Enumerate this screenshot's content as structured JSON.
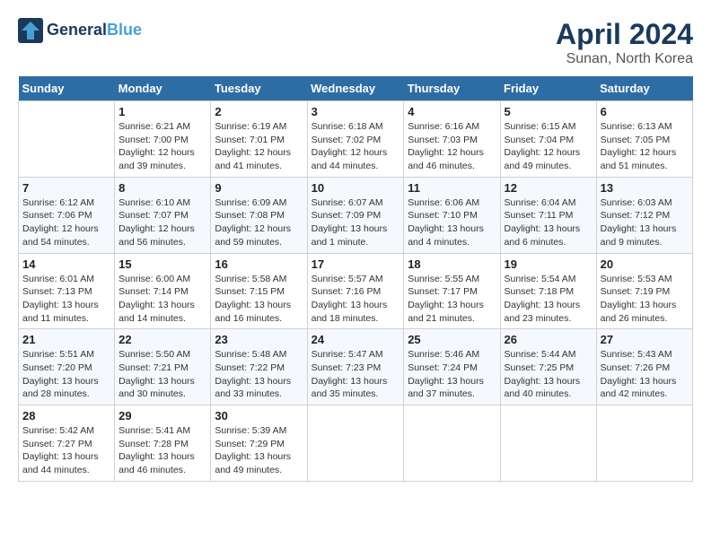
{
  "header": {
    "logo_line1": "General",
    "logo_line2": "Blue",
    "month_title": "April 2024",
    "subtitle": "Sunan, North Korea"
  },
  "days_of_week": [
    "Sunday",
    "Monday",
    "Tuesday",
    "Wednesday",
    "Thursday",
    "Friday",
    "Saturday"
  ],
  "weeks": [
    [
      {
        "day": "",
        "info": ""
      },
      {
        "day": "1",
        "info": "Sunrise: 6:21 AM\nSunset: 7:00 PM\nDaylight: 12 hours\nand 39 minutes."
      },
      {
        "day": "2",
        "info": "Sunrise: 6:19 AM\nSunset: 7:01 PM\nDaylight: 12 hours\nand 41 minutes."
      },
      {
        "day": "3",
        "info": "Sunrise: 6:18 AM\nSunset: 7:02 PM\nDaylight: 12 hours\nand 44 minutes."
      },
      {
        "day": "4",
        "info": "Sunrise: 6:16 AM\nSunset: 7:03 PM\nDaylight: 12 hours\nand 46 minutes."
      },
      {
        "day": "5",
        "info": "Sunrise: 6:15 AM\nSunset: 7:04 PM\nDaylight: 12 hours\nand 49 minutes."
      },
      {
        "day": "6",
        "info": "Sunrise: 6:13 AM\nSunset: 7:05 PM\nDaylight: 12 hours\nand 51 minutes."
      }
    ],
    [
      {
        "day": "7",
        "info": "Sunrise: 6:12 AM\nSunset: 7:06 PM\nDaylight: 12 hours\nand 54 minutes."
      },
      {
        "day": "8",
        "info": "Sunrise: 6:10 AM\nSunset: 7:07 PM\nDaylight: 12 hours\nand 56 minutes."
      },
      {
        "day": "9",
        "info": "Sunrise: 6:09 AM\nSunset: 7:08 PM\nDaylight: 12 hours\nand 59 minutes."
      },
      {
        "day": "10",
        "info": "Sunrise: 6:07 AM\nSunset: 7:09 PM\nDaylight: 13 hours\nand 1 minute."
      },
      {
        "day": "11",
        "info": "Sunrise: 6:06 AM\nSunset: 7:10 PM\nDaylight: 13 hours\nand 4 minutes."
      },
      {
        "day": "12",
        "info": "Sunrise: 6:04 AM\nSunset: 7:11 PM\nDaylight: 13 hours\nand 6 minutes."
      },
      {
        "day": "13",
        "info": "Sunrise: 6:03 AM\nSunset: 7:12 PM\nDaylight: 13 hours\nand 9 minutes."
      }
    ],
    [
      {
        "day": "14",
        "info": "Sunrise: 6:01 AM\nSunset: 7:13 PM\nDaylight: 13 hours\nand 11 minutes."
      },
      {
        "day": "15",
        "info": "Sunrise: 6:00 AM\nSunset: 7:14 PM\nDaylight: 13 hours\nand 14 minutes."
      },
      {
        "day": "16",
        "info": "Sunrise: 5:58 AM\nSunset: 7:15 PM\nDaylight: 13 hours\nand 16 minutes."
      },
      {
        "day": "17",
        "info": "Sunrise: 5:57 AM\nSunset: 7:16 PM\nDaylight: 13 hours\nand 18 minutes."
      },
      {
        "day": "18",
        "info": "Sunrise: 5:55 AM\nSunset: 7:17 PM\nDaylight: 13 hours\nand 21 minutes."
      },
      {
        "day": "19",
        "info": "Sunrise: 5:54 AM\nSunset: 7:18 PM\nDaylight: 13 hours\nand 23 minutes."
      },
      {
        "day": "20",
        "info": "Sunrise: 5:53 AM\nSunset: 7:19 PM\nDaylight: 13 hours\nand 26 minutes."
      }
    ],
    [
      {
        "day": "21",
        "info": "Sunrise: 5:51 AM\nSunset: 7:20 PM\nDaylight: 13 hours\nand 28 minutes."
      },
      {
        "day": "22",
        "info": "Sunrise: 5:50 AM\nSunset: 7:21 PM\nDaylight: 13 hours\nand 30 minutes."
      },
      {
        "day": "23",
        "info": "Sunrise: 5:48 AM\nSunset: 7:22 PM\nDaylight: 13 hours\nand 33 minutes."
      },
      {
        "day": "24",
        "info": "Sunrise: 5:47 AM\nSunset: 7:23 PM\nDaylight: 13 hours\nand 35 minutes."
      },
      {
        "day": "25",
        "info": "Sunrise: 5:46 AM\nSunset: 7:24 PM\nDaylight: 13 hours\nand 37 minutes."
      },
      {
        "day": "26",
        "info": "Sunrise: 5:44 AM\nSunset: 7:25 PM\nDaylight: 13 hours\nand 40 minutes."
      },
      {
        "day": "27",
        "info": "Sunrise: 5:43 AM\nSunset: 7:26 PM\nDaylight: 13 hours\nand 42 minutes."
      }
    ],
    [
      {
        "day": "28",
        "info": "Sunrise: 5:42 AM\nSunset: 7:27 PM\nDaylight: 13 hours\nand 44 minutes."
      },
      {
        "day": "29",
        "info": "Sunrise: 5:41 AM\nSunset: 7:28 PM\nDaylight: 13 hours\nand 46 minutes."
      },
      {
        "day": "30",
        "info": "Sunrise: 5:39 AM\nSunset: 7:29 PM\nDaylight: 13 hours\nand 49 minutes."
      },
      {
        "day": "",
        "info": ""
      },
      {
        "day": "",
        "info": ""
      },
      {
        "day": "",
        "info": ""
      },
      {
        "day": "",
        "info": ""
      }
    ]
  ]
}
